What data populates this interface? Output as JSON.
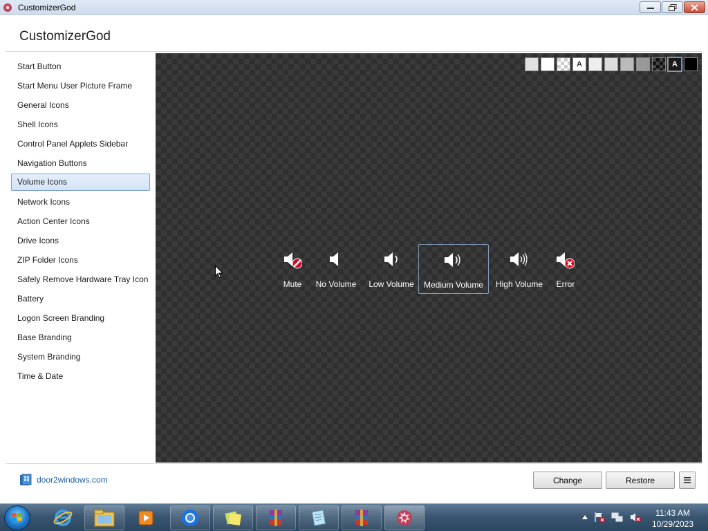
{
  "window": {
    "title": "CustomizerGod"
  },
  "header": {
    "title": "CustomizerGod"
  },
  "sidebar": {
    "items": [
      {
        "label": "Start Button"
      },
      {
        "label": "Start Menu User Picture Frame"
      },
      {
        "label": "General Icons"
      },
      {
        "label": "Shell Icons"
      },
      {
        "label": "Control Panel Applets Sidebar"
      },
      {
        "label": "Navigation Buttons"
      },
      {
        "label": "Volume Icons",
        "selected": true
      },
      {
        "label": "Network Icons"
      },
      {
        "label": "Action Center Icons"
      },
      {
        "label": "Drive Icons"
      },
      {
        "label": "ZIP Folder Icons"
      },
      {
        "label": "Safely Remove Hardware Tray Icon"
      },
      {
        "label": "Battery"
      },
      {
        "label": "Logon Screen Branding"
      },
      {
        "label": "Base Branding"
      },
      {
        "label": "System Branding"
      },
      {
        "label": "Time & Date"
      }
    ]
  },
  "preview": {
    "background_swatches": [
      {
        "color": "#e0e0e0"
      },
      {
        "color": "#ffffff"
      },
      {
        "color": "checker-light"
      },
      {
        "color": "#ffffff",
        "text": "A"
      },
      {
        "color": "#eeeeee"
      },
      {
        "color": "#dddddd"
      },
      {
        "color": "#bbbbbb"
      },
      {
        "color": "#999999"
      },
      {
        "color": "checker-dark",
        "selected": true
      },
      {
        "color": "#1a1a1a",
        "text": "A"
      },
      {
        "color": "#000000"
      }
    ],
    "volume_icons": [
      {
        "label": "Mute",
        "icon": "speaker-mute-icon"
      },
      {
        "label": "No Volume",
        "icon": "speaker-no-volume-icon"
      },
      {
        "label": "Low Volume",
        "icon": "speaker-low-volume-icon"
      },
      {
        "label": "Medium Volume",
        "icon": "speaker-medium-volume-icon",
        "selected": true
      },
      {
        "label": "High Volume",
        "icon": "speaker-high-volume-icon"
      },
      {
        "label": "Error",
        "icon": "speaker-error-icon"
      }
    ]
  },
  "footer": {
    "link_text": "door2windows.com",
    "change_label": "Change",
    "restore_label": "Restore",
    "menu_icon": "hamburger-menu-icon"
  },
  "taskbar": {
    "pinned": [
      "internet-explorer-icon",
      "file-explorer-icon",
      "media-player-icon",
      "chrome-icon",
      "sticky-notes-icon",
      "winrar-icon",
      "notepad-icon",
      "winrar-icon",
      "customizergod-icon"
    ],
    "tray_icons": [
      "show-hidden-icons-arrow",
      "action-center-flag-icon",
      "network-icon",
      "volume-icon"
    ],
    "time": "11:43 AM",
    "date": "10/29/2023"
  },
  "colors": {
    "selection": "#d4e4f8",
    "link": "#1d5fa8",
    "preview_bg": "#2f2f2f"
  }
}
